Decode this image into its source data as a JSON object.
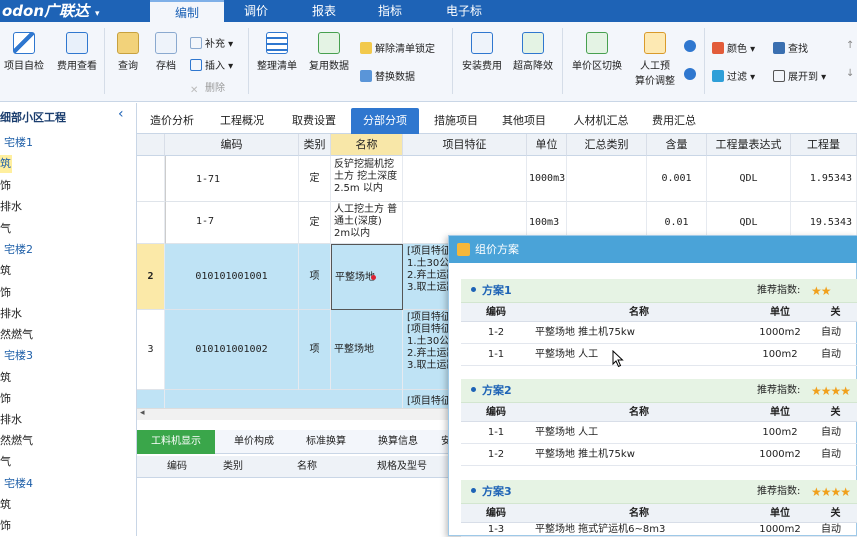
{
  "menu": {
    "logo": "odon广联达",
    "logo_arrow": "▾",
    "tabs": [
      "编制",
      "调价",
      "报表",
      "指标",
      "电子标"
    ]
  },
  "ribbon": {
    "project_check": "项目自检",
    "fee_view": "费用查看",
    "query": "查询",
    "save": "存档",
    "supplement": "补充",
    "insert": "插入",
    "delete": "删除",
    "organize_list": "整理清单",
    "reuse_data": "复用数据",
    "unlock_list": "解除清单锁定",
    "replace_data": "替换数据",
    "install_fee": "安装费用",
    "super_reduce": "超高降效",
    "unit_switch": "单价区切换",
    "manual_price_l1": "人工预",
    "manual_price_l2": "算价调整",
    "color": "颜色",
    "find": "查找",
    "filter": "过滤",
    "expand_to": "展开到"
  },
  "sidebar": {
    "items": [
      "细部小区工程",
      "宅楼1",
      "筑",
      "饰",
      "排水",
      "气",
      "宅楼2",
      "筑",
      "饰",
      "排水",
      "然燃气",
      "宅楼3",
      "筑",
      "饰",
      "排水",
      "然燃气",
      "气",
      "宅楼4",
      "筑",
      "饰"
    ]
  },
  "view_tabs": [
    "造价分析",
    "工程概况",
    "取费设置",
    "分部分项",
    "措施项目",
    "其他项目",
    "人材机汇总",
    "费用汇总"
  ],
  "grid": {
    "headers": [
      "编码",
      "类别",
      "名称",
      "项目特征",
      "单位",
      "汇总类别",
      "含量",
      "工程量表达式",
      "工程量"
    ],
    "rows": [
      {
        "num": "",
        "code": "1-71",
        "type": "定",
        "name": "反铲挖掘机挖土方 挖土深度2.5m 以内",
        "feature": "",
        "unit": "1000m3",
        "summary": "",
        "content": "0.001",
        "expr": "QDL",
        "qty": "1.95343"
      },
      {
        "num": "",
        "code": "1-7",
        "type": "定",
        "name": "人工挖土方 普通土(深度) 2m以内",
        "feature": "",
        "unit": "100m3",
        "summary": "",
        "content": "0.01",
        "expr": "QDL",
        "qty": "19.5343"
      },
      {
        "num": "2",
        "code": "010101001001",
        "type": "项",
        "name": "平整场地",
        "feature": "[项目特征]\n1.土30公分以\n2.弃土运距:\n3.取土运距:",
        "unit": "",
        "summary": "",
        "content": "",
        "expr": "",
        "qty": ""
      },
      {
        "num": "3",
        "code": "010101001002",
        "type": "项",
        "name": "平整场地",
        "feature": "[项目特征]\n[项目特征]\n1.土30公分以\n2.弃土运距:\n3.取土运距:",
        "unit": "",
        "summary": "",
        "content": "",
        "expr": "",
        "qty": ""
      },
      {
        "num": "",
        "code": "",
        "type": "",
        "name": "",
        "feature": "[项目特征]",
        "unit": "",
        "summary": "",
        "content": "",
        "expr": "",
        "qty": ""
      }
    ]
  },
  "bottom": {
    "tabs": [
      "工料机显示",
      "单价构成",
      "标准换算",
      "换算信息",
      "安"
    ],
    "headers": [
      "编码",
      "类别",
      "名称",
      "规格及型号"
    ]
  },
  "dialog": {
    "title": "组价方案",
    "recommend_label": "推荐指数:",
    "col_headers": [
      "编码",
      "名称",
      "单位",
      "关"
    ],
    "plans": [
      {
        "title": "方案1",
        "stars": "★★",
        "stars_value": 1.5,
        "rows": [
          {
            "code": "1-2",
            "name": "平整场地 推土机75kw",
            "unit": "1000m2",
            "extra": "自动"
          },
          {
            "code": "1-1",
            "name": "平整场地 人工",
            "unit": "100m2",
            "extra": "自动"
          }
        ]
      },
      {
        "title": "方案2",
        "stars": "★★★★",
        "stars_value": 4,
        "rows": [
          {
            "code": "1-1",
            "name": "平整场地 人工",
            "unit": "100m2",
            "extra": "自动"
          },
          {
            "code": "1-2",
            "name": "平整场地 推土机75kw",
            "unit": "1000m2",
            "extra": "自动"
          }
        ]
      },
      {
        "title": "方案3",
        "stars": "★★★★",
        "stars_value": 4,
        "rows": [
          {
            "code": "1-3",
            "name": "平整场地 拖式铲运机6~8m3",
            "unit": "1000m2",
            "extra": "自动"
          }
        ]
      }
    ]
  }
}
